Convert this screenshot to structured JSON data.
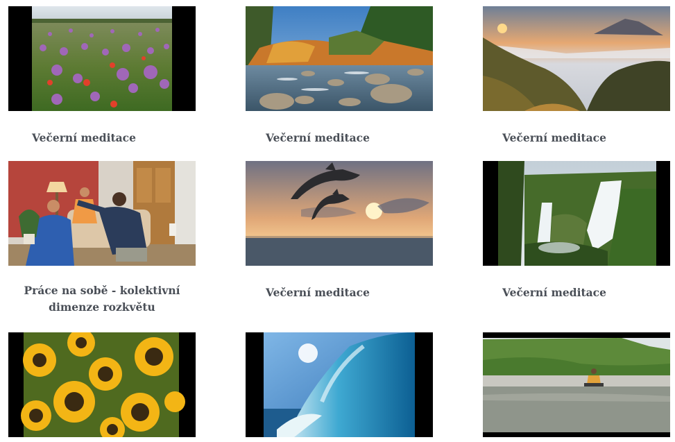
{
  "videos": [
    {
      "title": "Večerní meditace",
      "thumb_icon": "poppy-field-thumbnail"
    },
    {
      "title": "Večerní meditace",
      "thumb_icon": "autumn-river-thumbnail"
    },
    {
      "title": "Večerní meditace",
      "thumb_icon": "mountain-sunrise-thumbnail"
    },
    {
      "title": "Práce na sobě - kolektivní dimenze rozkvětu",
      "thumb_icon": "meditation-room-thumbnail"
    },
    {
      "title": "Večerní meditace",
      "thumb_icon": "dolphins-sunset-thumbnail"
    },
    {
      "title": "Večerní meditace",
      "thumb_icon": "waterfall-thumbnail"
    },
    {
      "title": "",
      "thumb_icon": "sunflowers-thumbnail"
    },
    {
      "title": "",
      "thumb_icon": "ocean-wave-thumbnail"
    },
    {
      "title": "",
      "thumb_icon": "river-meditation-thumbnail"
    }
  ],
  "colors": {
    "title_text": "#4a4f57",
    "letterbox": "#000000"
  }
}
